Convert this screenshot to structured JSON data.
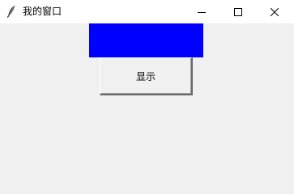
{
  "window": {
    "title": "我的窗口",
    "icon": "feather-icon",
    "controls": {
      "minimize_icon": "minimize-icon",
      "maximize_icon": "maximize-icon",
      "close_icon": "close-icon"
    }
  },
  "content": {
    "label_color": "#0000ff",
    "button_label": "显示"
  }
}
